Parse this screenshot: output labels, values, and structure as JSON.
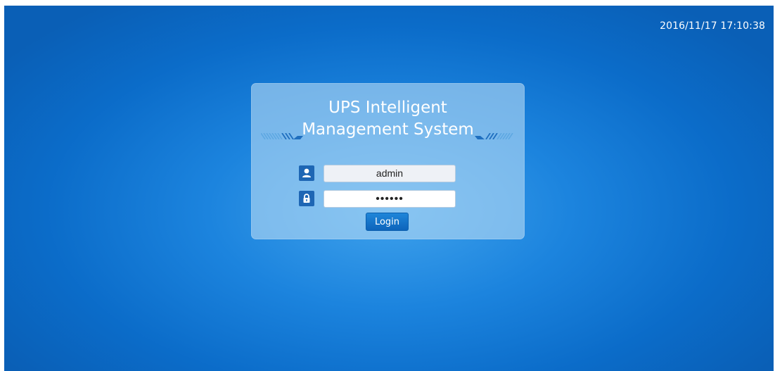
{
  "header": {
    "datetime": "2016/11/17 17:10:38"
  },
  "login": {
    "title_line1": "UPS Intelligent",
    "title_line2": "Management System",
    "username": {
      "value": "admin",
      "icon": "user-icon"
    },
    "password": {
      "value": "••••••",
      "icon": "lock-icon"
    },
    "button_label": "Login"
  },
  "colors": {
    "background_accent": "#1c84de",
    "panel": "#b9dcf5",
    "icon_box": "#1e66b4",
    "button": "#1679cc"
  }
}
